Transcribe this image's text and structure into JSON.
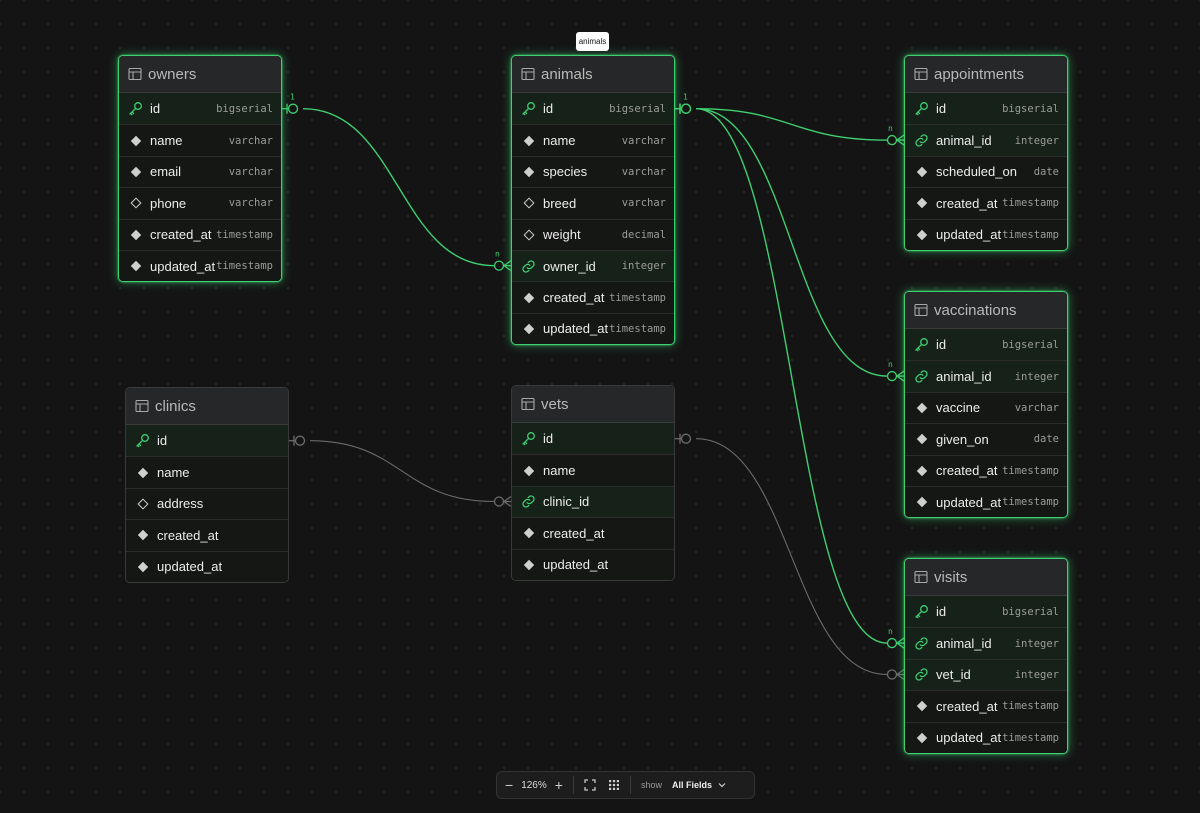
{
  "tooltip": "animals",
  "colors": {
    "canvas": "#141414",
    "accent_green": "#3fcf71",
    "inactive_edge": "#6b6b6b",
    "table_header": "#262728"
  },
  "icons": {
    "table": "table-icon",
    "primary_key": "key-icon",
    "foreign_key": "link-icon",
    "not_null": "filled-diamond-icon",
    "nullable": "hollow-diamond-icon"
  },
  "tables": {
    "owners": {
      "name": "owners",
      "fields": [
        {
          "name": "id",
          "type": "bigserial",
          "kind": "pk"
        },
        {
          "name": "name",
          "type": "varchar",
          "kind": "notnull"
        },
        {
          "name": "email",
          "type": "varchar",
          "kind": "notnull"
        },
        {
          "name": "phone",
          "type": "varchar",
          "kind": "nullable"
        },
        {
          "name": "created_at",
          "type": "timestamp",
          "kind": "notnull"
        },
        {
          "name": "updated_at",
          "type": "timestamp",
          "kind": "notnull"
        }
      ]
    },
    "animals": {
      "name": "animals",
      "fields": [
        {
          "name": "id",
          "type": "bigserial",
          "kind": "pk"
        },
        {
          "name": "name",
          "type": "varchar",
          "kind": "notnull"
        },
        {
          "name": "species",
          "type": "varchar",
          "kind": "notnull"
        },
        {
          "name": "breed",
          "type": "varchar",
          "kind": "nullable"
        },
        {
          "name": "weight",
          "type": "decimal",
          "kind": "nullable"
        },
        {
          "name": "owner_id",
          "type": "integer",
          "kind": "fk"
        },
        {
          "name": "created_at",
          "type": "timestamp",
          "kind": "notnull"
        },
        {
          "name": "updated_at",
          "type": "timestamp",
          "kind": "notnull"
        }
      ]
    },
    "appointments": {
      "name": "appointments",
      "fields": [
        {
          "name": "id",
          "type": "bigserial",
          "kind": "pk"
        },
        {
          "name": "animal_id",
          "type": "integer",
          "kind": "fk"
        },
        {
          "name": "scheduled_on",
          "type": "date",
          "kind": "notnull"
        },
        {
          "name": "created_at",
          "type": "timestamp",
          "kind": "notnull"
        },
        {
          "name": "updated_at",
          "type": "timestamp",
          "kind": "notnull"
        }
      ]
    },
    "vaccinations": {
      "name": "vaccinations",
      "fields": [
        {
          "name": "id",
          "type": "bigserial",
          "kind": "pk"
        },
        {
          "name": "animal_id",
          "type": "integer",
          "kind": "fk"
        },
        {
          "name": "vaccine",
          "type": "varchar",
          "kind": "notnull"
        },
        {
          "name": "given_on",
          "type": "date",
          "kind": "notnull"
        },
        {
          "name": "created_at",
          "type": "timestamp",
          "kind": "notnull"
        },
        {
          "name": "updated_at",
          "type": "timestamp",
          "kind": "notnull"
        }
      ]
    },
    "clinics": {
      "name": "clinics",
      "fields": [
        {
          "name": "id",
          "type": "",
          "kind": "pk"
        },
        {
          "name": "name",
          "type": "",
          "kind": "notnull"
        },
        {
          "name": "address",
          "type": "",
          "kind": "nullable"
        },
        {
          "name": "created_at",
          "type": "",
          "kind": "notnull"
        },
        {
          "name": "updated_at",
          "type": "",
          "kind": "notnull"
        }
      ]
    },
    "vets": {
      "name": "vets",
      "fields": [
        {
          "name": "id",
          "type": "",
          "kind": "pk"
        },
        {
          "name": "name",
          "type": "",
          "kind": "notnull"
        },
        {
          "name": "clinic_id",
          "type": "",
          "kind": "fk"
        },
        {
          "name": "created_at",
          "type": "",
          "kind": "notnull"
        },
        {
          "name": "updated_at",
          "type": "",
          "kind": "notnull"
        }
      ]
    },
    "visits": {
      "name": "visits",
      "fields": [
        {
          "name": "id",
          "type": "bigserial",
          "kind": "pk"
        },
        {
          "name": "animal_id",
          "type": "integer",
          "kind": "fk"
        },
        {
          "name": "vet_id",
          "type": "integer",
          "kind": "fk"
        },
        {
          "name": "created_at",
          "type": "timestamp",
          "kind": "notnull"
        },
        {
          "name": "updated_at",
          "type": "timestamp",
          "kind": "notnull"
        }
      ]
    }
  },
  "relations": [
    {
      "from": "owners.id",
      "to": "animals.owner_id",
      "from_label": "1",
      "to_label": "n",
      "active": true
    },
    {
      "from": "animals.id",
      "to": "appointments.animal_id",
      "from_label": "1",
      "to_label": "n",
      "active": true
    },
    {
      "from": "animals.id",
      "to": "vaccinations.animal_id",
      "from_label": "",
      "to_label": "n",
      "active": true
    },
    {
      "from": "animals.id",
      "to": "visits.animal_id",
      "from_label": "",
      "to_label": "n",
      "active": true
    },
    {
      "from": "clinics.id",
      "to": "vets.clinic_id",
      "from_label": "",
      "to_label": "",
      "active": false
    },
    {
      "from": "vets.id",
      "to": "visits.vet_id",
      "from_label": "",
      "to_label": "",
      "active": false
    }
  ],
  "toolbar": {
    "zoom": "126%",
    "zoom_out": "−",
    "zoom_in": "+",
    "show_label": "show",
    "fields_label": "All Fields"
  }
}
